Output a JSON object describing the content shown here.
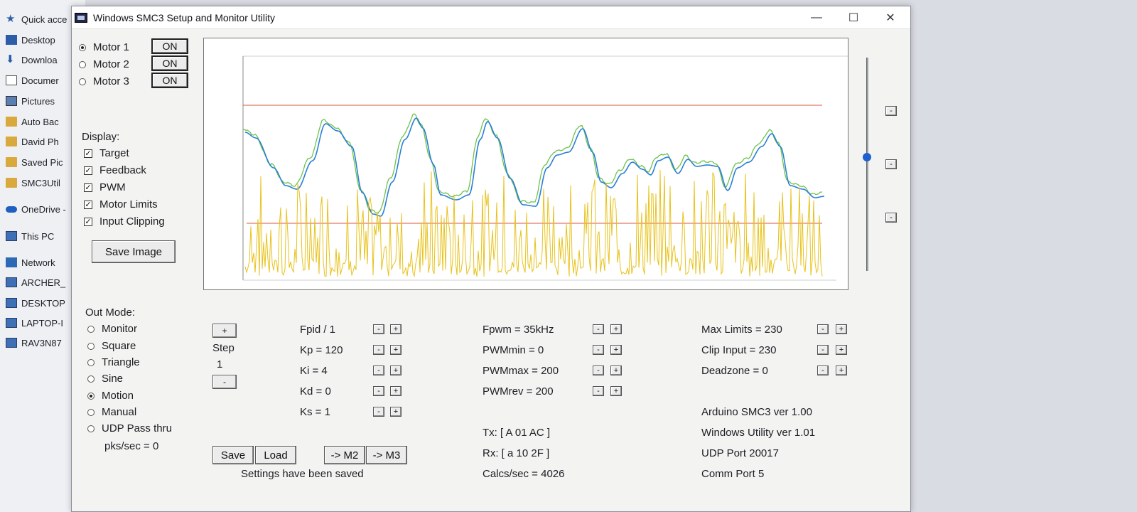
{
  "explorer": {
    "items": [
      {
        "label": "Quick acce",
        "icon": "star-icon"
      },
      {
        "label": "Desktop",
        "icon": "desktop-icon"
      },
      {
        "label": "Downloa",
        "icon": "download-arrow-icon"
      },
      {
        "label": "Documer",
        "icon": "document-icon"
      },
      {
        "label": "Pictures",
        "icon": "pictures-icon"
      },
      {
        "label": "Auto Bac",
        "icon": "folder-icon"
      },
      {
        "label": "David Ph",
        "icon": "folder-icon"
      },
      {
        "label": "Saved Pic",
        "icon": "folder-icon"
      },
      {
        "label": "SMC3Util",
        "icon": "folder-icon"
      },
      {
        "label": "OneDrive -",
        "icon": "cloud-icon"
      },
      {
        "label": "This PC",
        "icon": "computer-icon"
      },
      {
        "label": "Network",
        "icon": "network-icon"
      },
      {
        "label": "ARCHER_",
        "icon": "computer-icon"
      },
      {
        "label": "DESKTOP",
        "icon": "computer-icon"
      },
      {
        "label": "LAPTOP-I",
        "icon": "computer-icon"
      },
      {
        "label": "RAV3N87",
        "icon": "computer-icon"
      }
    ]
  },
  "window": {
    "title": "Windows SMC3 Setup and Monitor Utility",
    "minimize": "—",
    "maximize": "☐",
    "close": "✕"
  },
  "motors": [
    {
      "label": "Motor 1",
      "state": "ON",
      "selected": true
    },
    {
      "label": "Motor 2",
      "state": "ON",
      "selected": false
    },
    {
      "label": "Motor 3",
      "state": "ON",
      "selected": false
    }
  ],
  "display": {
    "heading": "Display:",
    "options": [
      {
        "label": "Target",
        "checked": true
      },
      {
        "label": "Feedback",
        "checked": true
      },
      {
        "label": "PWM",
        "checked": true
      },
      {
        "label": "Motor Limits",
        "checked": true
      },
      {
        "label": "Input Clipping",
        "checked": true
      }
    ],
    "save_image": "Save Image"
  },
  "out_mode": {
    "heading": "Out Mode:",
    "options": [
      {
        "label": "Monitor",
        "selected": false
      },
      {
        "label": "Square",
        "selected": false
      },
      {
        "label": "Triangle",
        "selected": false
      },
      {
        "label": "Sine",
        "selected": false
      },
      {
        "label": "Motion",
        "selected": true
      },
      {
        "label": "Manual",
        "selected": false
      },
      {
        "label": "UDP Pass thru",
        "selected": false
      }
    ],
    "pks_sec": "pks/sec = 0"
  },
  "step": {
    "plus": "+",
    "label": "Step",
    "value": "1",
    "minus": "-"
  },
  "pid": {
    "fpid": "Fpid / 1",
    "kp": "Kp = 120",
    "ki": "Ki = 4",
    "kd": "Kd = 0",
    "ks": "Ks = 1"
  },
  "pwm": {
    "fpwm": "Fpwm = 35kHz",
    "pwmmin": "PWMmin = 0",
    "pwmmax": "PWMmax = 200",
    "pwmrev": "PWMrev = 200"
  },
  "limits": {
    "max": "Max Limits = 230",
    "clip": "Clip Input = 230",
    "deadzone": "Deadzone = 0"
  },
  "comm": {
    "tx": "Tx: [ A 01 AC ]",
    "rx": "Rx: [ a 10 2F ]",
    "calcs": "Calcs/sec = 4026"
  },
  "info": {
    "arduino": "Arduino SMC3 ver 1.00",
    "windows": "Windows Utility ver 1.01",
    "udp": "UDP Port 20017",
    "comm_port": "Comm Port 5"
  },
  "buttons": {
    "save": "Save",
    "load": "Load",
    "to_m2": "-> M2",
    "to_m3": "-> M3",
    "minus": "-",
    "plus": "+"
  },
  "status": "Settings have been saved",
  "slider_level": 0.6,
  "colors": {
    "target": "#6cc24a",
    "feedback": "#2a7fd6",
    "pwm": "#e8c21a",
    "limits": "#d9573a",
    "slider": "#1f5fd0"
  }
}
